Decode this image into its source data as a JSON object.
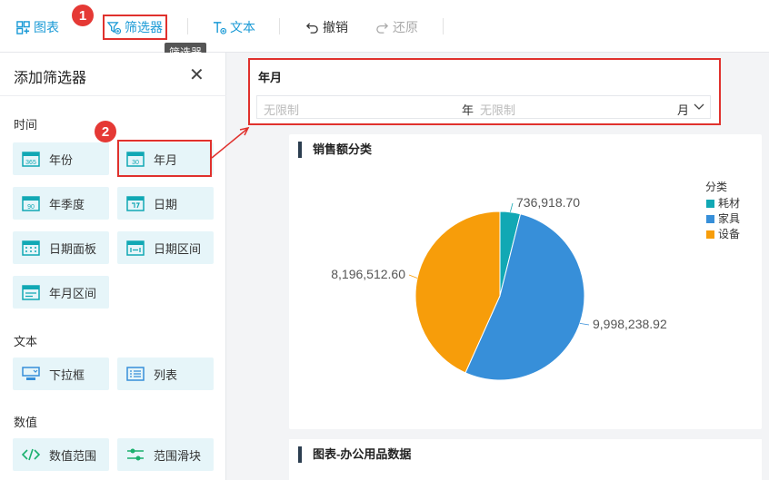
{
  "toolbar": {
    "chart_label": "图表",
    "filter_label": "筛选器",
    "text_label": "文本",
    "undo_label": "撤销",
    "redo_label": "还原",
    "tooltip": "筛选器"
  },
  "annotations": {
    "step1": "1",
    "step2": "2"
  },
  "sidebar": {
    "title": "添加筛选器",
    "sections": {
      "time": "时间",
      "text": "文本",
      "number": "数值"
    },
    "time_items": [
      "年份",
      "年月",
      "年季度",
      "日期",
      "日期面板",
      "日期区间",
      "年月区间"
    ],
    "text_items": [
      "下拉框",
      "列表"
    ],
    "number_items": [
      "数值范围",
      "范围滑块"
    ],
    "icon_labels": {
      "year": "365",
      "month": "30",
      "quarter": "90"
    }
  },
  "filter": {
    "title": "年月",
    "year_placeholder": "无限制",
    "year_unit": "年",
    "month_placeholder": "无限制",
    "month_unit": "月"
  },
  "chart": {
    "title": "销售额分类",
    "legend_title": "分类",
    "colors": {
      "耗材": "#11a8b4",
      "家具": "#378fd9",
      "设备": "#f79d0a"
    }
  },
  "chart_data": {
    "type": "pie",
    "title": "销售额分类",
    "legend_title": "分类",
    "categories": [
      "耗材",
      "家具",
      "设备"
    ],
    "values": [
      736918.7,
      9998238.92,
      8196512.6
    ],
    "data_labels": [
      "736,918.70",
      "9,998,238.92",
      "8,196,512.60"
    ],
    "colors": [
      "#11a8b4",
      "#378fd9",
      "#f79d0a"
    ],
    "legend_placement": "top-right"
  },
  "table": {
    "title": "图表-办公用品数据"
  }
}
